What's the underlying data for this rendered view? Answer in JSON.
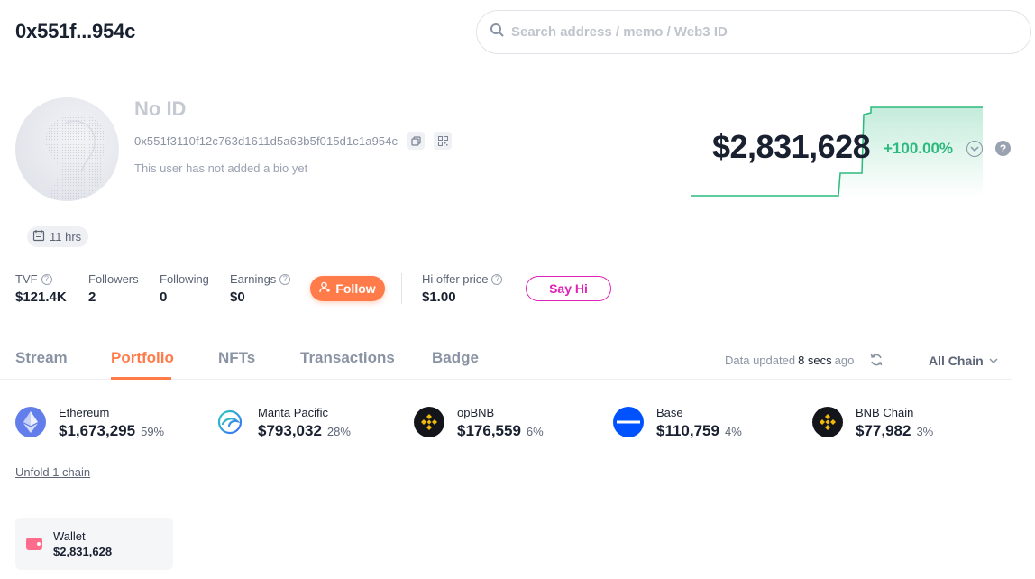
{
  "header": {
    "address_short": "0x551f...954c"
  },
  "search": {
    "placeholder": "Search address / memo / Web3 ID"
  },
  "profile": {
    "name": "No ID",
    "address": "0x551f3110f12c763d1611d5a63b5f015d1c1a954c",
    "bio": "This user has not added a bio yet",
    "age": "11 hrs"
  },
  "net_worth": {
    "value": "$2,831,628",
    "change": "+100.00%",
    "change_color": "#2bba7d",
    "help_label": "?"
  },
  "stats": {
    "tvf": {
      "label": "TVF",
      "value": "$121.4K"
    },
    "followers": {
      "label": "Followers",
      "value": "2"
    },
    "following": {
      "label": "Following",
      "value": "0"
    },
    "earnings": {
      "label": "Earnings",
      "value": "$0"
    },
    "hi_offer": {
      "label": "Hi offer price",
      "value": "$1.00"
    }
  },
  "actions": {
    "follow": "Follow",
    "say_hi": "Say Hi"
  },
  "tabs": [
    {
      "label": "Stream",
      "active": false
    },
    {
      "label": "Portfolio",
      "active": true
    },
    {
      "label": "NFTs",
      "active": false
    },
    {
      "label": "Transactions",
      "active": false
    },
    {
      "label": "Badge",
      "active": false
    }
  ],
  "data_updated": {
    "prefix": "Data updated",
    "time": "8 secs",
    "suffix": "ago"
  },
  "chain_filter": {
    "selected": "All Chain"
  },
  "chains": [
    {
      "name": "Ethereum",
      "amount": "$1,673,295",
      "percent": "59%",
      "icon": "ethereum-icon"
    },
    {
      "name": "Manta Pacific",
      "amount": "$793,032",
      "percent": "28%",
      "icon": "manta-icon"
    },
    {
      "name": "opBNB",
      "amount": "$176,559",
      "percent": "6%",
      "icon": "bnb-icon"
    },
    {
      "name": "Base",
      "amount": "$110,759",
      "percent": "4%",
      "icon": "base-icon"
    },
    {
      "name": "BNB Chain",
      "amount": "$77,982",
      "percent": "3%",
      "icon": "bnb-icon"
    }
  ],
  "unfold_label": "Unfold 1 chain",
  "wallet": {
    "label": "Wallet",
    "value": "$2,831,628"
  },
  "colors": {
    "accent": "#ff7b49",
    "say_hi": "#e023b6",
    "positive": "#2bba7d"
  }
}
